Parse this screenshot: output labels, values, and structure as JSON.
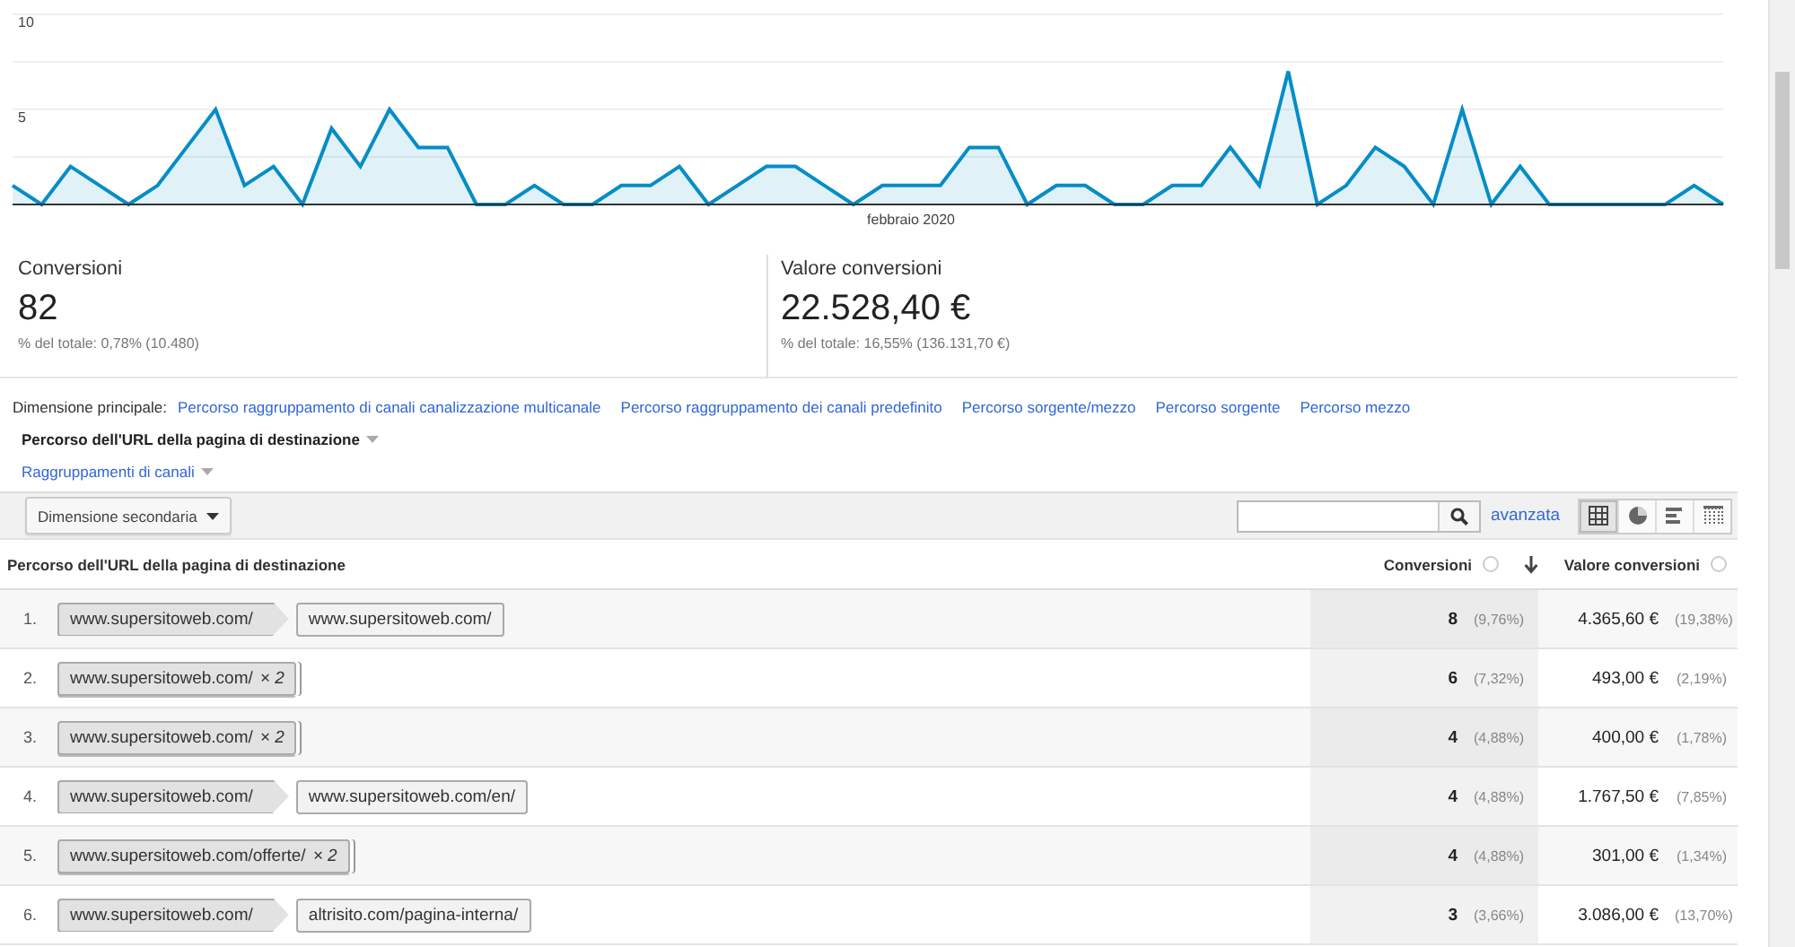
{
  "chart": {
    "chart_data": {
      "type": "area",
      "series": [
        {
          "color": "#058dc7",
          "values": [
            1,
            0,
            2,
            1,
            0,
            1,
            3,
            5,
            1,
            2,
            0,
            4,
            2,
            5,
            3,
            3,
            0,
            0,
            1,
            0,
            0,
            1,
            1,
            2,
            0,
            1,
            2,
            2,
            1,
            0,
            1,
            1,
            1,
            3,
            3,
            0,
            1,
            1,
            0,
            0,
            1,
            1,
            3,
            1,
            7,
            0,
            1,
            3,
            2,
            0,
            5,
            0,
            2,
            0,
            0,
            0,
            0,
            0,
            1,
            0
          ]
        }
      ],
      "ylim": [
        0,
        10
      ],
      "yticks": [
        {
          "value": 5,
          "label": "5"
        },
        {
          "value": 10,
          "label": "10"
        }
      ],
      "xlabel": "febbraio 2020"
    }
  },
  "metrics": [
    {
      "label": "Conversioni",
      "value": "82",
      "share": "% del totale: 0,78% (10.480)"
    },
    {
      "label": "Valore conversioni",
      "value": "22.528,40 €",
      "share": "% del totale: 16,55% (136.131,70 €)"
    }
  ],
  "dimensions": {
    "label": "Dimensione principale:",
    "options": [
      {
        "label": "Percorso raggruppamento di canali canalizzazione multicanale",
        "kind": "link",
        "selected": false
      },
      {
        "label": "Percorso raggruppamento dei canali predefinito",
        "kind": "link",
        "selected": false
      },
      {
        "label": "Percorso sorgente/mezzo",
        "kind": "link",
        "selected": false
      },
      {
        "label": "Percorso sorgente",
        "kind": "link",
        "selected": false
      },
      {
        "label": "Percorso mezzo",
        "kind": "link",
        "selected": false
      },
      {
        "label": "Percorso dell'URL della pagina di destinazione",
        "kind": "dropdown",
        "selected": true
      },
      {
        "label": "Raggruppamenti di canali",
        "kind": "dropdown",
        "selected": false
      }
    ]
  },
  "toolbar": {
    "secondary_dimension": "Dimensione secondaria",
    "advanced": "avanzata",
    "views": [
      {
        "kind": "table",
        "selected": true
      },
      {
        "kind": "pie",
        "selected": false
      },
      {
        "kind": "bar",
        "selected": false
      },
      {
        "kind": "pivot",
        "selected": false
      }
    ]
  },
  "table": {
    "columns": [
      {
        "label": "Percorso dell'URL della pagina di destinazione",
        "help": false,
        "sorted": false
      },
      {
        "label": "Conversioni",
        "help": true,
        "sorted": true
      },
      {
        "label": "Valore conversioni",
        "help": true,
        "sorted": false
      }
    ],
    "rows": [
      {
        "index": "1.",
        "path": [
          {
            "url": "www.supersitoweb.com/"
          },
          {
            "url": "www.supersitoweb.com/"
          }
        ],
        "conversions": "8",
        "conversions_share": "(9,76%)",
        "value": "4.365,60 €",
        "value_share": "(19,38%)"
      },
      {
        "index": "2.",
        "path": [
          {
            "url": "www.supersitoweb.com/",
            "repeat": "× 2"
          }
        ],
        "conversions": "6",
        "conversions_share": "(7,32%)",
        "value": "493,00 €",
        "value_share": "(2,19%)"
      },
      {
        "index": "3.",
        "path": [
          {
            "url": "www.supersitoweb.com/",
            "repeat": "× 2"
          }
        ],
        "conversions": "4",
        "conversions_share": "(4,88%)",
        "value": "400,00 €",
        "value_share": "(1,78%)"
      },
      {
        "index": "4.",
        "path": [
          {
            "url": "www.supersitoweb.com/"
          },
          {
            "url": "www.supersitoweb.com/en/"
          }
        ],
        "conversions": "4",
        "conversions_share": "(4,88%)",
        "value": "1.767,50 €",
        "value_share": "(7,85%)"
      },
      {
        "index": "5.",
        "path": [
          {
            "url": "www.supersitoweb.com/offerte/",
            "repeat": "× 2"
          }
        ],
        "conversions": "4",
        "conversions_share": "(4,88%)",
        "value": "301,00 €",
        "value_share": "(1,34%)"
      },
      {
        "index": "6.",
        "path": [
          {
            "url": "www.supersitoweb.com/"
          },
          {
            "url": "altrisito.com/pagina-interna/"
          }
        ],
        "conversions": "3",
        "conversions_share": "(3,66%)",
        "value": "3.086,00 €",
        "value_share": "(13,70%)"
      }
    ]
  }
}
